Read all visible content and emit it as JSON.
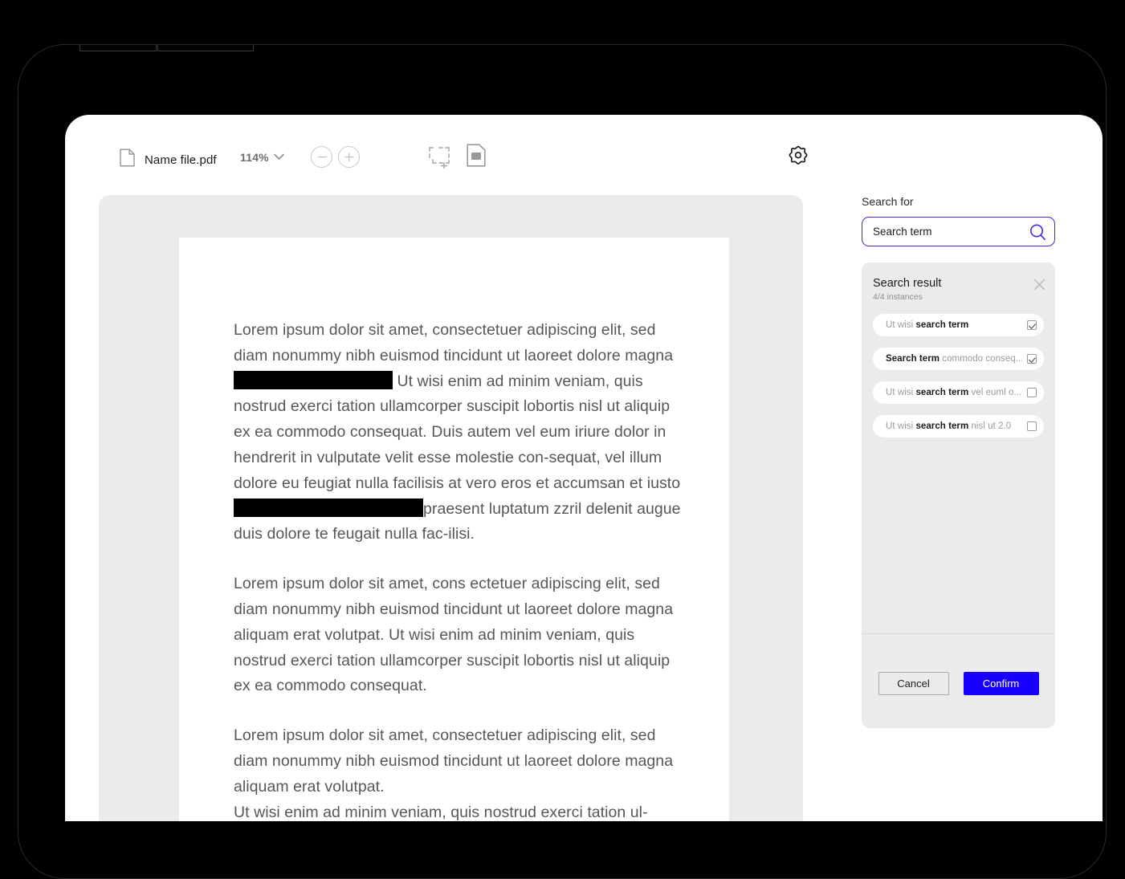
{
  "toolbar": {
    "file_icon": "document-icon",
    "file_name": "Name file.pdf",
    "zoom_value": "114%",
    "zoom_caret_icon": "chevron-down-icon",
    "zoom_out_icon": "minus-circle-icon",
    "zoom_in_icon": "plus-circle-icon",
    "select_region_icon": "add-selection-icon",
    "page_thumb_icon": "page-image-icon",
    "settings_icon": "gear-icon"
  },
  "document": {
    "paragraphs": [
      {
        "segments": [
          {
            "type": "text",
            "value": "Lorem ipsum dolor sit amet, consectetuer adipiscing elit, sed diam nonummy nibh euismod tincidunt ut laoreet dolore magna "
          },
          {
            "type": "redaction",
            "value": ""
          },
          {
            "type": "text",
            "value": " Ut wisi enim ad minim veniam, quis nostrud exerci tation ullamcorper suscipit lobortis nisl ut aliquip ex ea commodo consequat. Duis autem vel eum iriure dolor in hendrerit in vulputate velit esse molestie con-sequat, vel illum dolore eu feugiat nulla facilisis at vero eros et accumsan et iusto "
          },
          {
            "type": "redaction",
            "value": ""
          },
          {
            "type": "text",
            "value": "praesent luptatum zzril delenit augue duis dolore te feugait nulla fac-ilisi."
          }
        ]
      },
      {
        "segments": [
          {
            "type": "text",
            "value": "Lorem ipsum dolor sit amet, cons ectetuer adipiscing elit, sed diam nonummy nibh euismod tincidunt ut laoreet dolore magna aliquam erat volutpat. Ut wisi enim ad minim veniam, quis nostrud exerci tation ullamcorper suscipit lobortis nisl ut aliquip ex ea commodo consequat."
          }
        ]
      },
      {
        "segments": [
          {
            "type": "text",
            "value": "Lorem ipsum dolor sit amet, consectetuer adipiscing elit, sed diam nonummy nibh euismod tincidunt ut laoreet dolore magna aliquam erat volutpat."
          }
        ]
      },
      {
        "segments": [
          {
            "type": "text",
            "value": "Ut wisi enim ad minim veniam, quis nostrud exerci tation ul-"
          }
        ]
      }
    ]
  },
  "sidebar": {
    "search_label": "Search for",
    "search_value": "Search term",
    "search_placeholder": "Search term",
    "search_icon": "magnifier-icon",
    "results": {
      "title": "Search result",
      "count_text": "4/4 instances",
      "close_icon": "close-icon",
      "items": [
        {
          "prefix": "Ut wisi ",
          "match": "search term",
          "suffix": "",
          "checked": true
        },
        {
          "prefix": "",
          "match": "Search term",
          "suffix": " commodo conseq...",
          "checked": true
        },
        {
          "prefix": "Ut wisi ",
          "match": "search term",
          "suffix": " vel euml o...",
          "checked": false
        },
        {
          "prefix": "Ut wisi ",
          "match": "search term",
          "suffix": " nisl ut 2.0",
          "checked": false
        }
      ]
    },
    "cancel_label": "Cancel",
    "confirm_label": "Confirm"
  },
  "colors": {
    "accent_border": "#4b23e6",
    "confirm_bg": "#1800ff",
    "viewer_bg": "#ebebe9",
    "page_bg": "#ffffff",
    "body_text": "#575757"
  }
}
